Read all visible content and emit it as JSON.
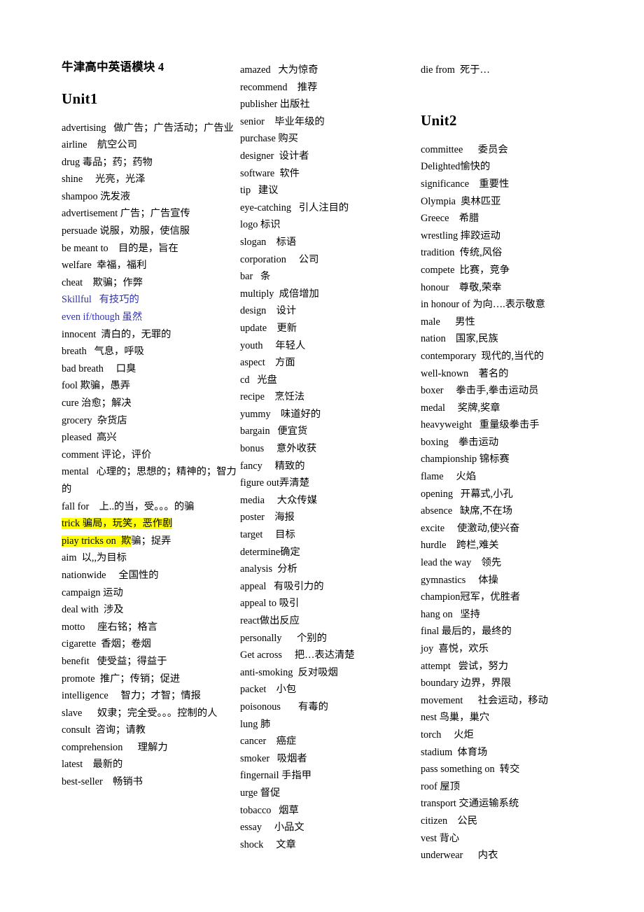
{
  "document": {
    "title": "牛津高中英语模块 4",
    "colors": {
      "text": "#000000",
      "blue_entry": "#3333aa",
      "highlight": "#ffff00",
      "page_background": "#ffffff"
    }
  },
  "columns": [
    {
      "name": "column-1",
      "title": "牛津高中英语模块 4",
      "unit_heading": "Unit1",
      "entries": [
        {
          "text": "advertising   做广告；广告活动；广告业"
        },
        {
          "text": "airline    航空公司"
        },
        {
          "text": "drug 毒品；药；药物"
        },
        {
          "text": "shine     光亮，光泽"
        },
        {
          "text": "shampoo 洗发液"
        },
        {
          "text": "advertisement 广告；广告宣传"
        },
        {
          "text": "persuade 说服，劝服，使信服"
        },
        {
          "text": "be meant to    目的是，旨在"
        },
        {
          "text": "welfare  幸福，福利"
        },
        {
          "text": "cheat    欺骗；作弊"
        },
        {
          "text": "Skillful   有技巧的",
          "style": "blue"
        },
        {
          "text": "even if/though 虽然",
          "style": "blue"
        },
        {
          "text": "innocent  清白的，无罪的"
        },
        {
          "text": "breath   气息，呼吸"
        },
        {
          "text": "bad breath     口臭"
        },
        {
          "text": "fool 欺骗，愚弄"
        },
        {
          "text": "cure 治愈；解决"
        },
        {
          "text": "grocery  杂货店"
        },
        {
          "text": "pleased  高兴"
        },
        {
          "text": "comment 评论，评价"
        },
        {
          "text": "mental   心理的；思想的；精神的；智力的"
        },
        {
          "text": "fall for    上..的当，受。。。的骗"
        },
        {
          "text": "trick 骗局，玩笑，恶作剧",
          "style": "highlight-full"
        },
        {
          "text": "piay tricks on  欺骗；捉弄",
          "style": "highlight-partial",
          "highlight_text": "piay tricks on  欺",
          "rest_text": "骗；捉弄"
        },
        {
          "text": "aim  以,,为目标"
        },
        {
          "text": "nationwide     全国性的"
        },
        {
          "text": "campaign 运动"
        },
        {
          "text": "deal with  涉及"
        },
        {
          "text": "motto     座右铭；格言"
        },
        {
          "text": "cigarette  香烟；卷烟"
        },
        {
          "text": "benefit   使受益；得益于"
        },
        {
          "text": "promote  推广；传销；促进"
        },
        {
          "text": "intelligence     智力；才智；情报"
        },
        {
          "text": "slave      奴隶；完全受。。。控制的人"
        },
        {
          "text": "consult  咨询；请教"
        },
        {
          "text": "comprehension      理解力"
        },
        {
          "text": "latest    最新的"
        },
        {
          "text": "best-seller    畅销书"
        }
      ]
    },
    {
      "name": "column-2",
      "entries": [
        {
          "text": "amazed   大为惊奇"
        },
        {
          "text": "recommend    推荐"
        },
        {
          "text": "publisher 出版社"
        },
        {
          "text": "senior    毕业年级的"
        },
        {
          "text": "purchase 购买"
        },
        {
          "text": "designer  设计者"
        },
        {
          "text": "software  软件"
        },
        {
          "text": "tip   建议"
        },
        {
          "text": "eye-catching   引人注目的"
        },
        {
          "text": "logo 标识"
        },
        {
          "text": "slogan    标语"
        },
        {
          "text": "corporation     公司"
        },
        {
          "text": "bar   条"
        },
        {
          "text": "multiply  成倍增加"
        },
        {
          "text": "design    设计"
        },
        {
          "text": "update    更新"
        },
        {
          "text": "youth     年轻人"
        },
        {
          "text": "aspect    方面"
        },
        {
          "text": "cd   光盘"
        },
        {
          "text": "recipe    烹饪法"
        },
        {
          "text": "yummy    味道好的"
        },
        {
          "text": "bargain   便宜货"
        },
        {
          "text": "bonus     意外收获"
        },
        {
          "text": "fancy     精致的"
        },
        {
          "text": "figure out弄清楚"
        },
        {
          "text": "media     大众传媒"
        },
        {
          "text": "poster    海报"
        },
        {
          "text": "target     目标"
        },
        {
          "text": "determine确定"
        },
        {
          "text": "analysis  分析"
        },
        {
          "text": "appeal   有吸引力的"
        },
        {
          "text": "appeal to 吸引"
        },
        {
          "text": "react做出反应"
        },
        {
          "text": "personally      个别的"
        },
        {
          "text": "Get across     把…表达清楚"
        },
        {
          "text": "anti-smoking  反对吸烟"
        },
        {
          "text": "packet    小包"
        },
        {
          "text": "poisonous       有毒的"
        },
        {
          "text": "lung 肺"
        },
        {
          "text": "cancer    癌症"
        },
        {
          "text": "smoker   吸烟者"
        },
        {
          "text": "fingernail 手指甲"
        },
        {
          "text": "urge 督促"
        },
        {
          "text": "tobacco   烟草"
        },
        {
          "text": "essay     小品文"
        },
        {
          "text": "shock     文章"
        }
      ]
    },
    {
      "name": "column-3",
      "top_entry": "die from  死于…",
      "unit_heading": "Unit2",
      "entries": [
        {
          "text": "committee      委员会"
        },
        {
          "text": "Delighted愉快的"
        },
        {
          "text": "significance    重要性"
        },
        {
          "text": "Olympia  奥林匹亚"
        },
        {
          "text": "Greece    希腊"
        },
        {
          "text": "wrestling 摔跤运动"
        },
        {
          "text": "tradition  传统,风俗"
        },
        {
          "text": "compete  比赛，竞争"
        },
        {
          "text": "honour    尊敬,荣幸"
        },
        {
          "text": "in honour of 为向….表示敬意"
        },
        {
          "text": "male      男性"
        },
        {
          "text": "nation    国家,民族"
        },
        {
          "text": "contemporary  现代的,当代的"
        },
        {
          "text": "well-known    著名的"
        },
        {
          "text": "boxer     拳击手,拳击运动员"
        },
        {
          "text": "medal     奖牌,奖章"
        },
        {
          "text": "heavyweight   重量级拳击手"
        },
        {
          "text": "boxing    拳击运动"
        },
        {
          "text": "championship 锦标赛"
        },
        {
          "text": "flame     火焰"
        },
        {
          "text": "opening   开幕式,小孔"
        },
        {
          "text": "absence   缺席,不在场"
        },
        {
          "text": "excite     使激动,使兴奋"
        },
        {
          "text": "hurdle    跨栏,难关"
        },
        {
          "text": "lead the way    领先"
        },
        {
          "text": "gymnastics     体操"
        },
        {
          "text": "champion冠军，优胜者"
        },
        {
          "text": "hang on   坚持"
        },
        {
          "text": "final 最后的，最终的"
        },
        {
          "text": "joy  喜悦，欢乐"
        },
        {
          "text": "attempt   尝试，努力"
        },
        {
          "text": "boundary 边界，界限"
        },
        {
          "text": "movement      社会运动，移动"
        },
        {
          "text": "nest 鸟巢，巢穴"
        },
        {
          "text": "torch     火炬"
        },
        {
          "text": "stadium  体育场"
        },
        {
          "text": "pass something on  转交"
        },
        {
          "text": "roof 屋顶"
        },
        {
          "text": "transport 交通运输系统"
        },
        {
          "text": "citizen    公民"
        },
        {
          "text": "vest 背心"
        },
        {
          "text": "underwear      内衣"
        }
      ]
    }
  ]
}
